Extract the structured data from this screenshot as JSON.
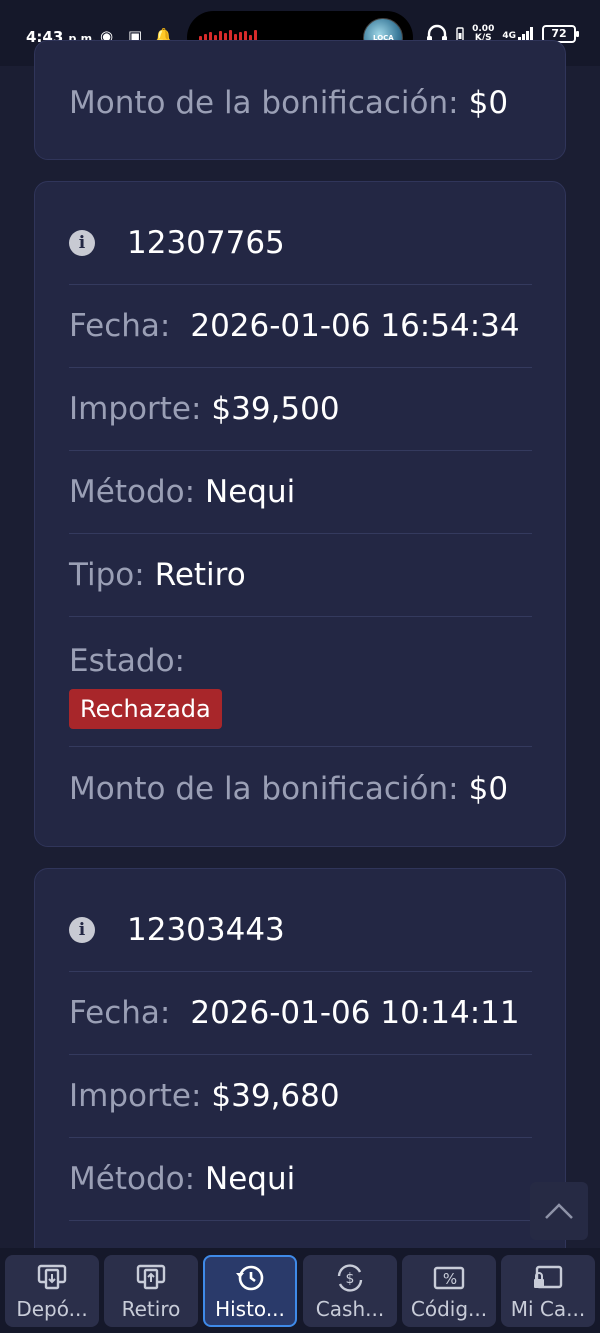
{
  "status_bar": {
    "time": "4:43",
    "ampm": "p.m.",
    "speed_value": "0.00",
    "speed_unit": "K/S",
    "network": "4G",
    "battery": "72",
    "island_label": "LOCA"
  },
  "cards": [
    {
      "bonus_label": "Monto de la bonificación:",
      "bonus_value": "$0"
    },
    {
      "id": "12307765",
      "date_label": "Fecha:",
      "date_value": "2026-01-06 16:54:34",
      "amount_label": "Importe:",
      "amount_value": "$39,500",
      "method_label": "Método:",
      "method_value": "Nequi",
      "type_label": "Tipo:",
      "type_value": "Retiro",
      "status_label": "Estado:",
      "status_value": "Rechazada",
      "bonus_label": "Monto de la bonificación:",
      "bonus_value": "$0"
    },
    {
      "id": "12303443",
      "date_label": "Fecha:",
      "date_value": "2026-01-06 10:14:11",
      "amount_label": "Importe:",
      "amount_value": "$39,680",
      "method_label": "Método:",
      "method_value": "Nequi"
    }
  ],
  "colors": {
    "background": "#1b1e33",
    "card": "#232744",
    "rejected_badge": "#a8262a",
    "active_tab_border": "#3f8ae8"
  },
  "bottom_nav": [
    {
      "label": "Depó...",
      "icon": "deposit-icon",
      "active": false
    },
    {
      "label": "Retiro",
      "icon": "withdraw-icon",
      "active": false
    },
    {
      "label": "Histo...",
      "icon": "history-icon",
      "active": true
    },
    {
      "label": "Cash...",
      "icon": "cashback-icon",
      "active": false
    },
    {
      "label": "Códig...",
      "icon": "coupon-icon",
      "active": false
    },
    {
      "label": "Mi Ca...",
      "icon": "account-icon",
      "active": false
    }
  ]
}
